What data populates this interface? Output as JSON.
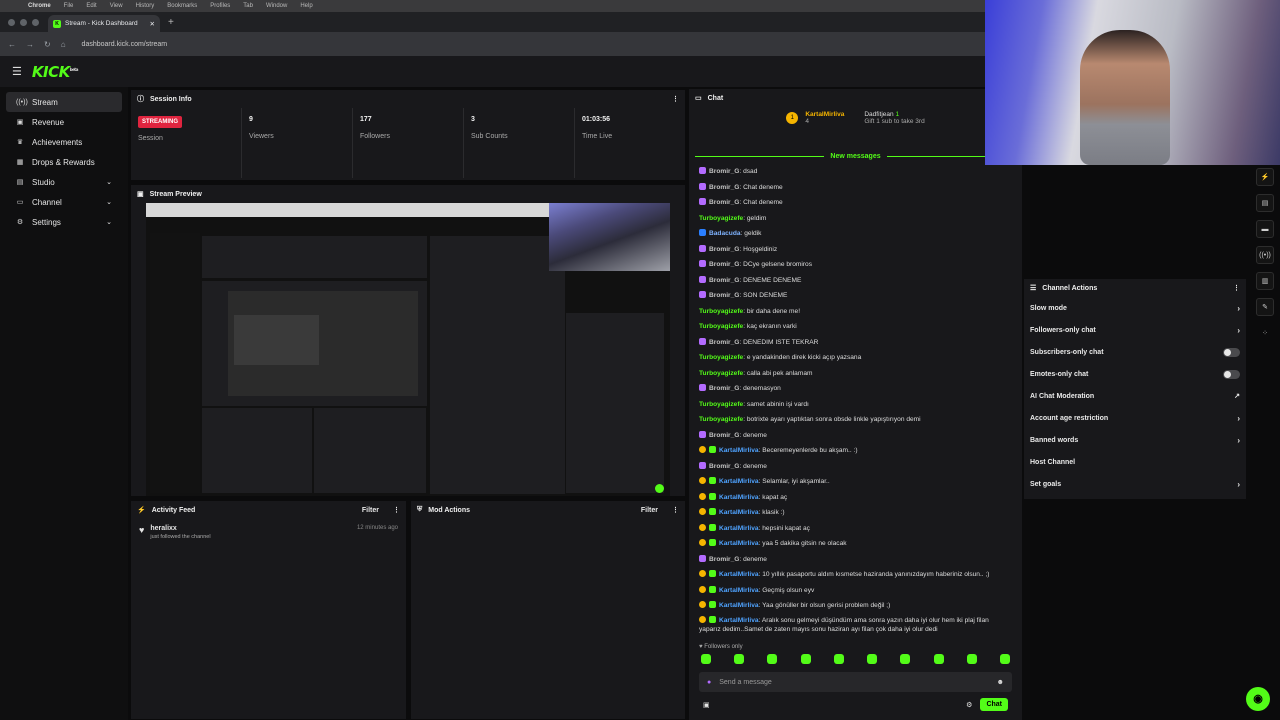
{
  "mac_menu": [
    "Chrome",
    "File",
    "Edit",
    "View",
    "History",
    "Bookmarks",
    "Profiles",
    "Tab",
    "Window",
    "Help"
  ],
  "browser": {
    "tab_title": "Stream - Kick Dashboard",
    "url": "dashboard.kick.com/stream"
  },
  "brand": {
    "logo": "KICK",
    "logo_sup": "beta",
    "accent": "#53fc18"
  },
  "sidebar": {
    "items": [
      {
        "label": "Stream",
        "icon": "stream-icon"
      },
      {
        "label": "Revenue",
        "icon": "revenue-icon"
      },
      {
        "label": "Achievements",
        "icon": "trophy-icon"
      },
      {
        "label": "Drops & Rewards",
        "icon": "gift-icon"
      },
      {
        "label": "Studio",
        "icon": "studio-icon"
      },
      {
        "label": "Channel",
        "icon": "channel-icon"
      },
      {
        "label": "Settings",
        "icon": "gear-icon"
      }
    ]
  },
  "session": {
    "title": "Session Info",
    "badge": "STREAMING",
    "stats": [
      {
        "value": "",
        "label": "Session"
      },
      {
        "value": "9",
        "label": "Viewers"
      },
      {
        "value": "177",
        "label": "Followers"
      },
      {
        "value": "3",
        "label": "Sub Counts"
      },
      {
        "value": "01:03:56",
        "label": "Time Live"
      }
    ]
  },
  "preview": {
    "title": "Stream Preview"
  },
  "activity": {
    "title": "Activity Feed",
    "filter": "Filter",
    "item": {
      "user": "heralixx",
      "text": "just followed the channel",
      "time": "12 minutes ago"
    }
  },
  "mod_actions": {
    "title": "Mod Actions",
    "filter": "Filter"
  },
  "chat": {
    "title": "Chat",
    "top1": {
      "rank": "1",
      "name": "KartalMirliva",
      "count": "4"
    },
    "top2": {
      "name": "Dadfitjean",
      "count": "1",
      "sub": "Gift 1 sub to take 3rd"
    },
    "new_messages": "New messages",
    "messages": [
      {
        "user": "Bromir_G",
        "text": "dsad",
        "color": "#c2c2c2",
        "badge": "mic"
      },
      {
        "user": "Bromir_G",
        "text": "Chat deneme",
        "color": "#c2c2c2",
        "badge": "mic"
      },
      {
        "user": "Bromir_G",
        "text": "Chat deneme",
        "color": "#c2c2c2",
        "badge": "mic"
      },
      {
        "user": "Turboyagizefe",
        "text": "geldim",
        "color": "#53fc18",
        "badge": ""
      },
      {
        "user": "Badacuda",
        "text": "geldik",
        "color": "#7fb3ff",
        "badge": "blue"
      },
      {
        "user": "Bromir_G",
        "text": "Hoşgeldiniz",
        "color": "#c2c2c2",
        "badge": "mic"
      },
      {
        "user": "Bromir_G",
        "text": "DCye gelsene bromiros",
        "color": "#c2c2c2",
        "badge": "mic"
      },
      {
        "user": "Bromir_G",
        "text": "DENEME DENEME",
        "color": "#c2c2c2",
        "badge": "mic"
      },
      {
        "user": "Bromir_G",
        "text": "SON DENEME",
        "color": "#c2c2c2",
        "badge": "mic"
      },
      {
        "user": "Turboyagizefe",
        "text": "bir daha dene me!",
        "color": "#53fc18",
        "badge": ""
      },
      {
        "user": "Turboyagizefe",
        "text": "kaç ekranın varki",
        "color": "#53fc18",
        "badge": ""
      },
      {
        "user": "Bromir_G",
        "text": "DENEDIM ISTE TEKRAR",
        "color": "#c2c2c2",
        "badge": "mic"
      },
      {
        "user": "Turboyagizefe",
        "text": "e yandakinden direk kicki açıp yazsana",
        "color": "#53fc18",
        "badge": ""
      },
      {
        "user": "Turboyagizefe",
        "text": "calla abi pek anlamam",
        "color": "#53fc18",
        "badge": ""
      },
      {
        "user": "Bromir_G",
        "text": "denemasyon",
        "color": "#c2c2c2",
        "badge": "mic"
      },
      {
        "user": "Turboyagizefe",
        "text": "samet abinin işi vardı",
        "color": "#53fc18",
        "badge": ""
      },
      {
        "user": "Turboyagizefe",
        "text": "botrixte ayarı yaptıktan sonra obsde linkle yapıştırıyon demi",
        "color": "#53fc18",
        "badge": ""
      },
      {
        "user": "Bromir_G",
        "text": "deneme",
        "color": "#c2c2c2",
        "badge": "mic"
      },
      {
        "user": "KartalMirliva",
        "text": "Becereme​yenlerde bu akşam.. :)",
        "color": "#4fa3ff",
        "badge": "gold"
      },
      {
        "user": "Bromir_G",
        "text": "deneme",
        "color": "#c2c2c2",
        "badge": "mic"
      },
      {
        "user": "KartalMirliva",
        "text": "Selamlar, iyi akşamlar..",
        "color": "#4fa3ff",
        "badge": "gold"
      },
      {
        "user": "KartalMirliva",
        "text": "kapat aç",
        "color": "#4fa3ff",
        "badge": "gold"
      },
      {
        "user": "KartalMirliva",
        "text": "klasik :)",
        "color": "#4fa3ff",
        "badge": "gold"
      },
      {
        "user": "KartalMirliva",
        "text": "hepsini kapat aç",
        "color": "#4fa3ff",
        "badge": "gold"
      },
      {
        "user": "KartalMirliva",
        "text": "yaa 5 dakika gitsin ne olacak",
        "color": "#4fa3ff",
        "badge": "gold"
      },
      {
        "user": "Bromir_G",
        "text": "deneme",
        "color": "#c2c2c2",
        "badge": "mic"
      },
      {
        "user": "KartalMirliva",
        "text": "10 yıllık pasaportu aldım kısmetse haziranda yanınızdayım haberiniz olsun.. ;)",
        "color": "#4fa3ff",
        "badge": "gold"
      },
      {
        "user": "KartalMirliva",
        "text": "Geçmiş olsun eyv",
        "color": "#4fa3ff",
        "badge": "gold"
      },
      {
        "user": "KartalMirliva",
        "text": "Yaa gönüller bir olsun gerisi problem değil ;)",
        "color": "#4fa3ff",
        "badge": "gold"
      },
      {
        "user": "KartalMirliva",
        "text": "Aralık sonu gelmeyi düşündüm ama sonra yazın daha iyi olur hem iki plaj filan yaparız dedim..Samet de zaten mayıs sonu haziran ayı filan çok daha iyi olur dedi",
        "color": "#4fa3ff",
        "badge": "gold",
        "wrap": true
      }
    ],
    "followers_only": "Followers only",
    "placeholder": "Send a message",
    "send_label": "Chat"
  },
  "channel_actions": {
    "title": "Channel Actions",
    "rows": [
      {
        "label": "Slow mode",
        "control": "arrow"
      },
      {
        "label": "Followers-only chat",
        "control": "arrow"
      },
      {
        "label": "Subscribers-only chat",
        "control": "toggle"
      },
      {
        "label": "Emotes-only chat",
        "control": "toggle"
      },
      {
        "label": "AI Chat Moderation",
        "control": "external"
      },
      {
        "label": "Account age restriction",
        "control": "arrow"
      },
      {
        "label": "Banned words",
        "control": "arrow"
      },
      {
        "label": "Host Channel",
        "control": "none"
      },
      {
        "label": "Set goals",
        "control": "arrow"
      }
    ]
  }
}
